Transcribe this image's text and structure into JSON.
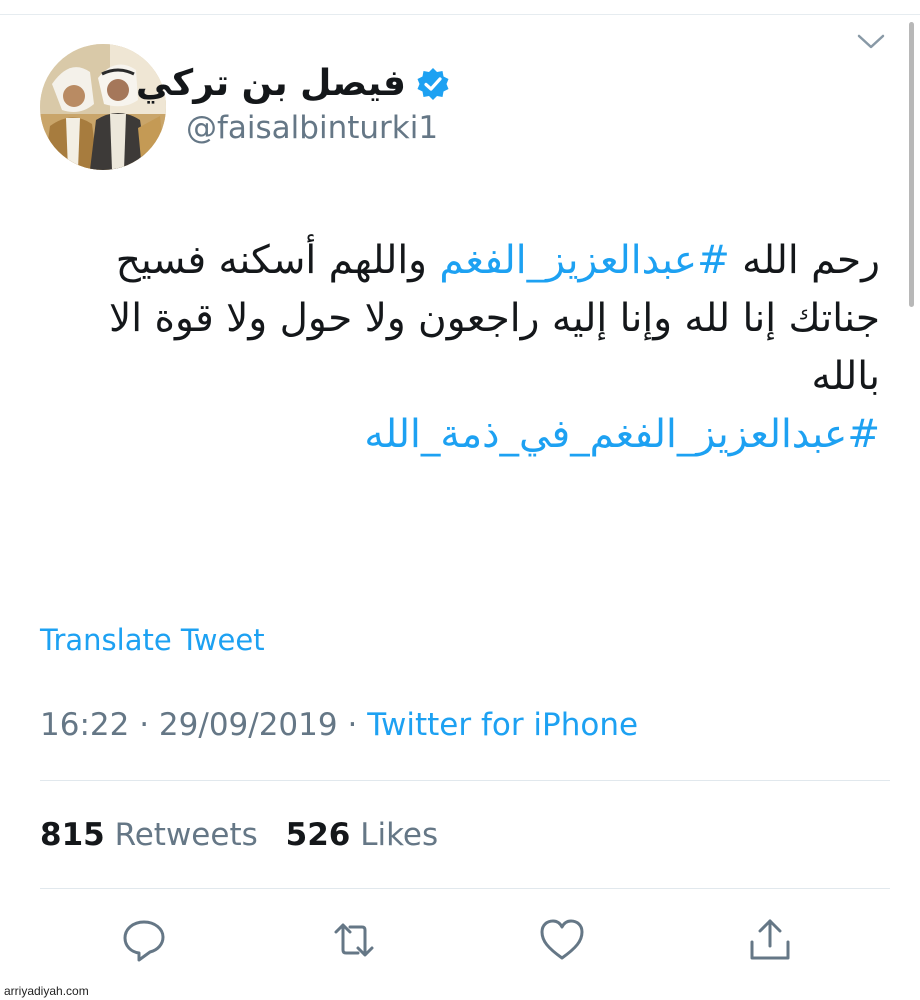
{
  "author": {
    "display_name": "فيصل بن تركي",
    "handle": "@faisalbinturki1"
  },
  "tweet": {
    "text_part1": "رحم الله ",
    "hashtag1": "#عبدالعزيز_الفغم",
    "text_part2": " واللهم أسكنه فسيح جناتك إنا لله وإنا إليه راجعون ولا حول ولا قوة الا بالله",
    "hashtag2": "#عبدالعزيز_الفغم_في_ذمة_الله"
  },
  "translate_label": "Translate Tweet",
  "meta": {
    "time": "16:22",
    "separator": "·",
    "date": "29/09/2019",
    "source": "Twitter for iPhone"
  },
  "stats": {
    "retweets_count": "815",
    "retweets_label": "Retweets",
    "likes_count": "526",
    "likes_label": "Likes"
  },
  "icons": {
    "caret": "chevron-down-icon",
    "verified": "verified-badge-icon",
    "reply": "reply-icon",
    "retweet": "retweet-icon",
    "like": "heart-icon",
    "share": "share-icon"
  },
  "colors": {
    "accent": "#1da1f2",
    "text": "#14171a",
    "secondary": "#657786"
  },
  "watermark": "arriyadiyah.com"
}
